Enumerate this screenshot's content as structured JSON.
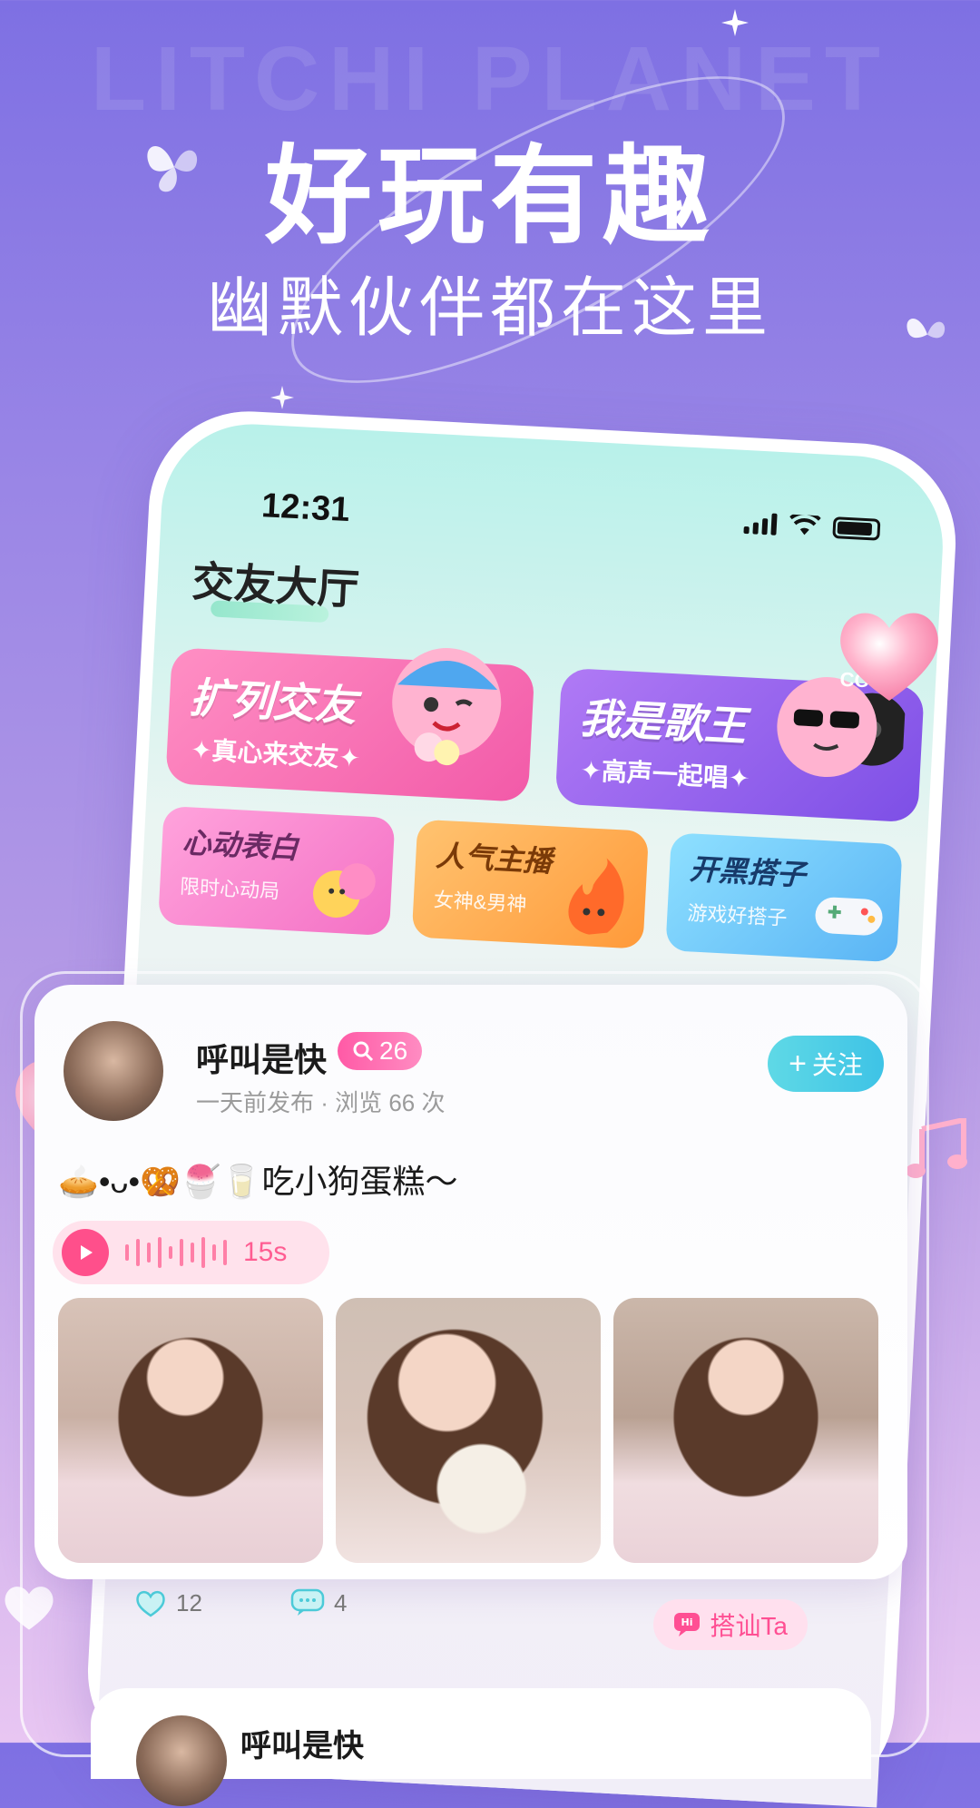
{
  "background_word": "LITCHI PLANET",
  "headline": "好玩有趣",
  "subline": "幽默伙伴都在这里",
  "status_bar": {
    "time": "12:31"
  },
  "hall": {
    "title": "交友大厅",
    "big_cards": [
      {
        "title": "扩列交友",
        "subtitle": "✦真心来交友✦"
      },
      {
        "title": "我是歌王",
        "subtitle": "✦高声一起唱✦"
      }
    ],
    "small_cards": [
      {
        "title": "心动表白",
        "subtitle": "限时心动局"
      },
      {
        "title": "人气主播",
        "subtitle": "女神&男神"
      },
      {
        "title": "开黑搭子",
        "subtitle": "游戏好搭子"
      }
    ],
    "badge_cool": "COOL"
  },
  "post": {
    "username": "呼叫是快",
    "level": "26",
    "meta": "一天前发布 · 浏览 66 次",
    "follow_label": "关注",
    "text": "🥧•ᴗ•🥨🍧🥛吃小狗蛋糕～",
    "voice_duration": "15s",
    "likes": "12",
    "comments": "4",
    "chat_label": "搭讪Ta"
  },
  "next_post": {
    "username": "呼叫是快"
  },
  "colors": {
    "accent_pink": "#ff4f8b",
    "accent_cyan": "#3ec3e6",
    "purple_bg": "#7e70e3"
  }
}
